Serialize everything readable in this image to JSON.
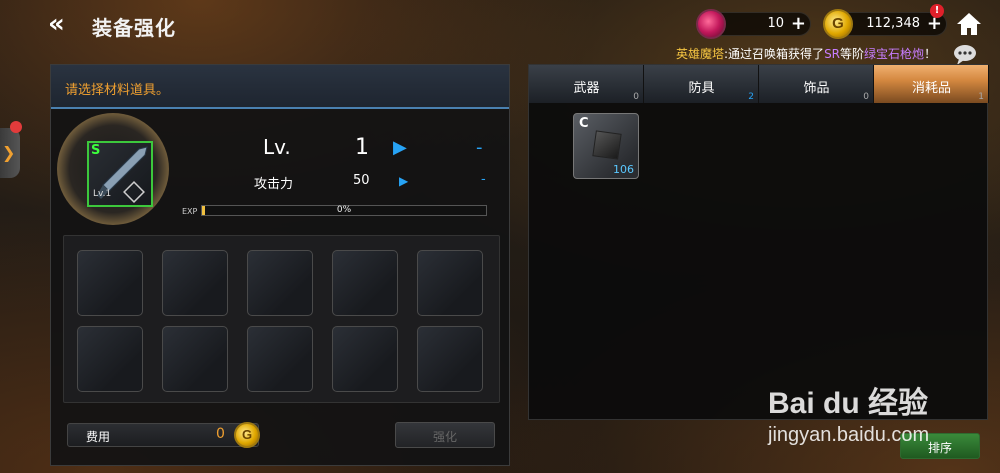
{
  "header": {
    "back_icon": "double-chevron-left-icon",
    "title": "装备强化"
  },
  "currency": {
    "gem": {
      "icon": "gem-icon",
      "value": "10",
      "plus": "+"
    },
    "gold": {
      "icon": "gold-coin-icon",
      "symbol": "G",
      "value": "112,348",
      "plus": "+",
      "alert": "!"
    }
  },
  "broadcast": {
    "hero": "英雄魔塔",
    "text1": ":通过召唤箱获得了",
    "sr": "SR",
    "text2": "等阶",
    "item": "绿宝石枪炮",
    "text3": "！"
  },
  "left_panel": {
    "instruction": "请选择材料道具。",
    "item": {
      "rank": "S",
      "level": "Lv.1"
    },
    "stats": {
      "lv_label": "Lv.",
      "lv_value": "1",
      "lv_next": "-",
      "atk_label": "攻击力",
      "atk_value": "50",
      "atk_next": "-"
    },
    "exp": {
      "label": "EXP",
      "percent_text": "0%",
      "fraction": 0.01
    },
    "material_slots": 10,
    "cost": {
      "label": "费用",
      "value": "0",
      "coin_symbol": "G"
    },
    "enhance_button": "强化"
  },
  "right_panel": {
    "tabs": [
      {
        "label": "武器",
        "count": "0",
        "active": false,
        "highlight": false
      },
      {
        "label": "防具",
        "count": "2",
        "active": false,
        "highlight": true
      },
      {
        "label": "饰品",
        "count": "0",
        "active": false,
        "highlight": false
      },
      {
        "label": "消耗品",
        "count": "1",
        "active": true,
        "highlight": false
      }
    ],
    "items": [
      {
        "rank": "C",
        "quantity": "106"
      }
    ],
    "sort_button": "排序"
  },
  "watermark": {
    "logo": "Bai du 经验",
    "url": "jingyan.baidu.com"
  }
}
